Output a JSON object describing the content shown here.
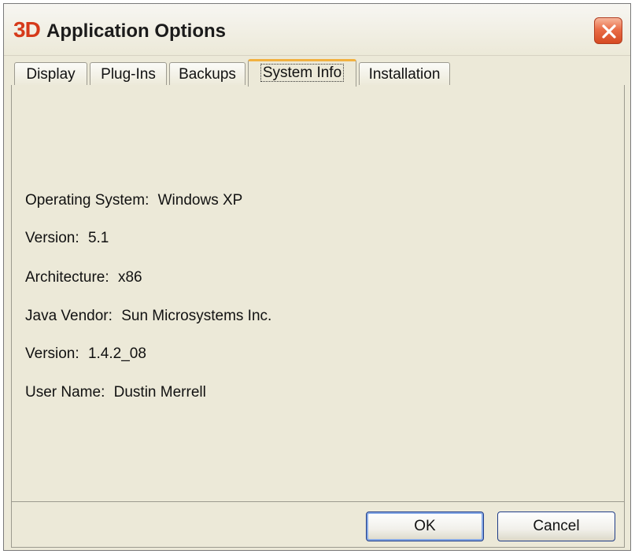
{
  "window": {
    "icon_text": "3D",
    "title": "Application Options"
  },
  "tabs": [
    {
      "label": "Display",
      "active": false
    },
    {
      "label": "Plug-Ins",
      "active": false
    },
    {
      "label": "Backups",
      "active": false
    },
    {
      "label": "System Info",
      "active": true
    },
    {
      "label": "Installation",
      "active": false
    }
  ],
  "system_info": {
    "os_label": "Operating System:",
    "os_value": "Windows XP",
    "os_version_label": "Version:",
    "os_version_value": "5.1",
    "arch_label": "Architecture:",
    "arch_value": "x86",
    "java_vendor_label": "Java Vendor:",
    "java_vendor_value": "Sun Microsystems Inc.",
    "java_version_label": "Version:",
    "java_version_value": "1.4.2_08",
    "user_label": "User Name:",
    "user_value": "Dustin Merrell"
  },
  "buttons": {
    "ok_label": "OK",
    "cancel_label": "Cancel"
  },
  "icons": {
    "close": "close-icon",
    "app": "app-logo-icon"
  },
  "colors": {
    "accent_tab": "#f2b13f",
    "close_button": "#e96d48",
    "logo": "#d63a1a",
    "window_bg": "#ece9d8"
  }
}
